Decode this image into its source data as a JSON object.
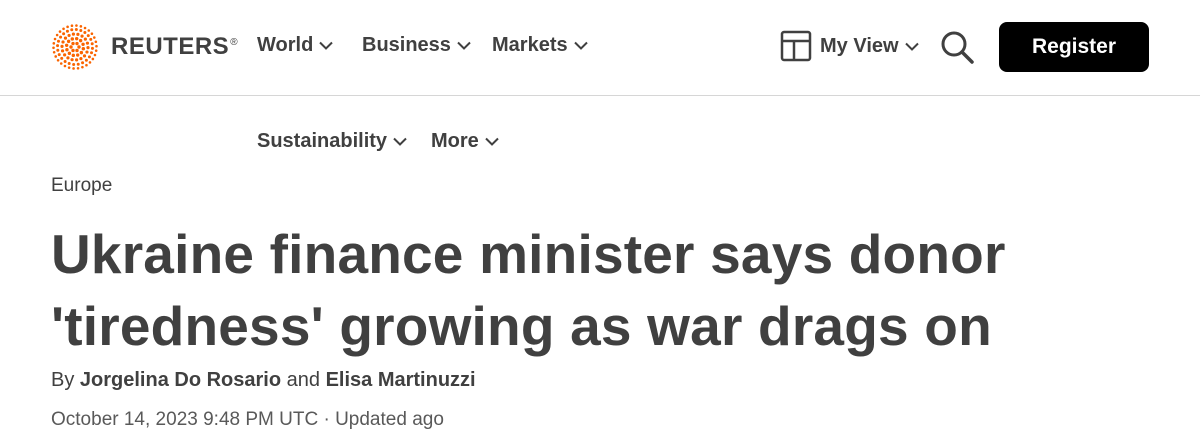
{
  "brand": {
    "name": "REUTERS",
    "registered_mark": "®",
    "brand_color": "#fa6400"
  },
  "nav": {
    "items": [
      {
        "label": "World",
        "icon": "chevron-down-icon"
      },
      {
        "label": "Business",
        "icon": "chevron-down-icon"
      },
      {
        "label": "Markets",
        "icon": "chevron-down-icon"
      },
      {
        "label": "Sustainability",
        "icon": "chevron-down-icon"
      },
      {
        "label": "More",
        "icon": "chevron-down-icon"
      }
    ],
    "my_view_label": "My View",
    "my_view_icon": "layout-icon",
    "search_icon": "search-icon",
    "register_label": "Register"
  },
  "article": {
    "section": "Europe",
    "headline": "Ukraine finance minister says donor 'tiredness' growing as war drags on",
    "byline_prefix": "By",
    "author_1": "Jorgelina Do Rosario",
    "byline_joiner": "and",
    "author_2": "Elisa Martinuzzi",
    "date": "October 14, 2023 9:48 PM UTC",
    "separator": "·",
    "updated": "Updated ago"
  },
  "colors": {
    "text": "#404040",
    "muted_text": "#595959",
    "button_bg": "#000000",
    "button_text": "#ffffff",
    "divider": "#d6d6d6"
  }
}
